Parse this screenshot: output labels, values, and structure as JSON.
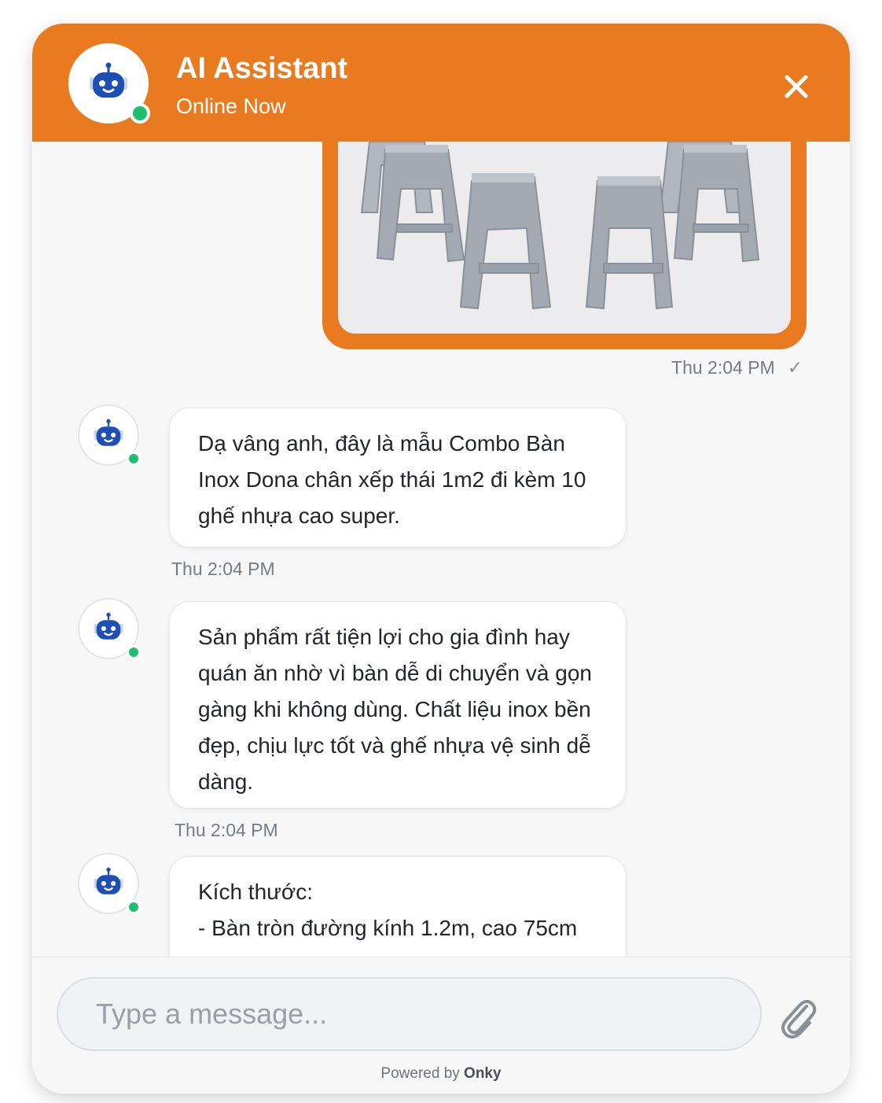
{
  "header": {
    "title": "AI Assistant",
    "status": "Online Now",
    "close_icon": "close-icon",
    "avatar_icon": "robot-icon"
  },
  "colors": {
    "accent": "#ea7a1f",
    "online": "#1fbf72",
    "robot_blue": "#1e4fb5"
  },
  "user_message": {
    "image_description_icon": "plastic-stools-photo",
    "time": "Thu 2:04 PM",
    "status_icon": "check-icon"
  },
  "bot_messages": [
    {
      "text": "Dạ vâng anh, đây là mẫu Combo Bàn Inox Dona chân xếp thái 1m2 đi kèm 10 ghế nhựa cao super.",
      "time": "Thu 2:04 PM"
    },
    {
      "text": "Sản phẩm rất tiện lợi cho gia đình hay quán ăn nhờ vì bàn dễ di chuyển và gọn gàng khi không dùng. Chất liệu inox bền đẹp, chịu lực tốt và ghế nhựa vệ sinh dễ dàng.",
      "time": "Thu 2:04 PM"
    },
    {
      "line1": "Kích thước:",
      "line2": "- Bàn tròn đường kính 1.2m, cao 75cm"
    }
  ],
  "composer": {
    "placeholder": "Type a message...",
    "attach_icon": "paperclip-icon"
  },
  "footer": {
    "powered_prefix": "Powered by",
    "brand": "Onky"
  }
}
